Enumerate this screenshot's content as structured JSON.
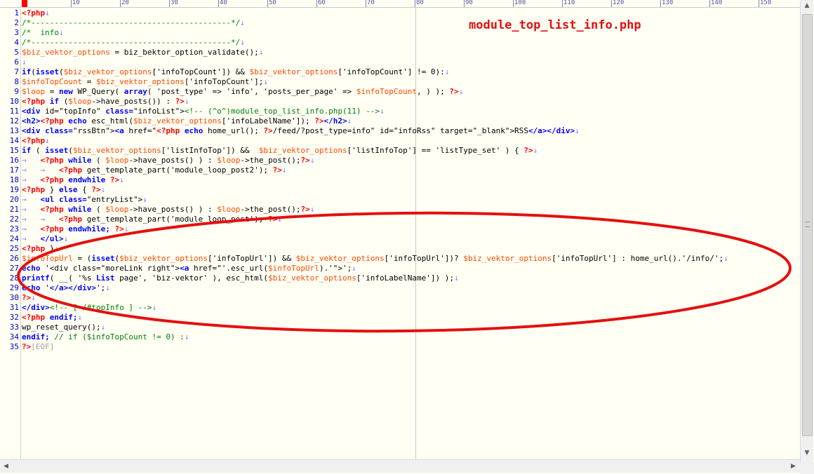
{
  "annotation": {
    "filename": "module_top_list_info.php"
  },
  "ruler": {
    "labels": [
      "10",
      "20",
      "30",
      "40",
      "50",
      "60",
      "70",
      "80",
      "90",
      "100",
      "110",
      "120",
      "130",
      "140",
      "150"
    ]
  },
  "lines": [
    {
      "num": "1",
      "tokens": [
        [
          "php",
          "<?php"
        ],
        [
          "nl",
          "↓"
        ]
      ]
    },
    {
      "num": "2",
      "tokens": [
        [
          "com",
          "/*-------------------------------------------*/"
        ],
        [
          "nl",
          "↓"
        ]
      ]
    },
    {
      "num": "3",
      "tokens": [
        [
          "com",
          "/*  info"
        ],
        [
          "nl",
          "↓"
        ]
      ]
    },
    {
      "num": "4",
      "tokens": [
        [
          "com",
          "/*-------------------------------------------*/"
        ],
        [
          "nl",
          "↓"
        ]
      ]
    },
    {
      "num": "5",
      "tokens": [
        [
          "var",
          "$biz_vektor_options"
        ],
        [
          "str",
          " = biz_bektor_option_validate();"
        ],
        [
          "nl",
          "↓"
        ]
      ]
    },
    {
      "num": "6",
      "tokens": [
        [
          "nl",
          "↓"
        ]
      ]
    },
    {
      "num": "7",
      "tokens": [
        [
          "kw",
          "if"
        ],
        [
          "str",
          "("
        ],
        [
          "kw",
          "isset"
        ],
        [
          "str",
          "("
        ],
        [
          "var",
          "$biz_vektor_options"
        ],
        [
          "str",
          "['infoTopCount']) && "
        ],
        [
          "var",
          "$biz_vektor_options"
        ],
        [
          "str",
          "['infoTopCount'] != 0):"
        ],
        [
          "nl",
          "↓"
        ]
      ]
    },
    {
      "num": "8",
      "tokens": [
        [
          "var",
          "$infoTopCount"
        ],
        [
          "str",
          " = "
        ],
        [
          "var",
          "$biz_vektor_options"
        ],
        [
          "str",
          "['infoTopCount'];"
        ],
        [
          "nl",
          "↓"
        ]
      ]
    },
    {
      "num": "9",
      "tokens": [
        [
          "var",
          "$loop"
        ],
        [
          "str",
          " = "
        ],
        [
          "kw",
          "new"
        ],
        [
          "str",
          " WP_Query( "
        ],
        [
          "kw",
          "array"
        ],
        [
          "str",
          "( 'post_type' => 'info', 'posts_per_page' => "
        ],
        [
          "var",
          "$infoTopCount"
        ],
        [
          "str",
          ", ) ); "
        ],
        [
          "php",
          "?>"
        ],
        [
          "nl",
          "↓"
        ]
      ]
    },
    {
      "num": "10",
      "tokens": [
        [
          "php",
          "<?php"
        ],
        [
          "str",
          " "
        ],
        [
          "kw",
          "if"
        ],
        [
          "str",
          " ("
        ],
        [
          "var",
          "$loop"
        ],
        [
          "str",
          "->have_posts()) : "
        ],
        [
          "php",
          "?>"
        ],
        [
          "nl",
          "↓"
        ]
      ]
    },
    {
      "num": "11",
      "tokens": [
        [
          "kw",
          "<div"
        ],
        [
          "str",
          " id=\"topInfo\" "
        ],
        [
          "kw",
          "class="
        ],
        [
          "str",
          "\"infoList\">"
        ],
        [
          "com",
          "<!-- (^o^)module_top_list_info.php(11) -->"
        ],
        [
          "nl",
          "↓"
        ]
      ]
    },
    {
      "num": "12",
      "tokens": [
        [
          "kw",
          "<h2>"
        ],
        [
          "php",
          "<?php"
        ],
        [
          "str",
          " "
        ],
        [
          "kw",
          "echo"
        ],
        [
          "str",
          " esc_html("
        ],
        [
          "var",
          "$biz_vektor_options"
        ],
        [
          "str",
          "['infoLabelName']); "
        ],
        [
          "php",
          "?>"
        ],
        [
          "kw",
          "</h2>"
        ],
        [
          "nl",
          "↓"
        ]
      ]
    },
    {
      "num": "13",
      "tokens": [
        [
          "kw",
          "<div"
        ],
        [
          "str",
          " "
        ],
        [
          "kw",
          "class="
        ],
        [
          "str",
          "\"rssBtn\">"
        ],
        [
          "kw",
          "<a"
        ],
        [
          "str",
          " href=\""
        ],
        [
          "php",
          "<?php"
        ],
        [
          "str",
          " "
        ],
        [
          "kw",
          "echo"
        ],
        [
          "str",
          " home_url(); "
        ],
        [
          "php",
          "?>"
        ],
        [
          "str",
          "/feed/?post_type=info\" id=\"infoRss\" target=\"_blank\">RSS"
        ],
        [
          "kw",
          "</a></div>"
        ],
        [
          "nl",
          "↓"
        ]
      ]
    },
    {
      "num": "14",
      "tokens": [
        [
          "php",
          "<?php"
        ],
        [
          "nl",
          "↓"
        ]
      ]
    },
    {
      "num": "15",
      "tokens": [
        [
          "kw",
          "if"
        ],
        [
          "str",
          " ( "
        ],
        [
          "kw",
          "isset"
        ],
        [
          "str",
          "("
        ],
        [
          "var",
          "$biz_vektor_options"
        ],
        [
          "str",
          "['listInfoTop']) &&  "
        ],
        [
          "var",
          "$biz_vektor_options"
        ],
        [
          "str",
          "['listInfoTop'] == 'listType_set' ) { "
        ],
        [
          "php",
          "?>"
        ],
        [
          "nl",
          "↓"
        ]
      ]
    },
    {
      "num": "16",
      "tokens": [
        [
          "tab",
          "→   "
        ],
        [
          "php",
          "<?php"
        ],
        [
          "str",
          " "
        ],
        [
          "kw",
          "while"
        ],
        [
          "str",
          " ( "
        ],
        [
          "var",
          "$loop"
        ],
        [
          "str",
          "->have_posts() ) : "
        ],
        [
          "var",
          "$loop"
        ],
        [
          "str",
          "->the_post();"
        ],
        [
          "php",
          "?>"
        ],
        [
          "nl",
          "↓"
        ]
      ]
    },
    {
      "num": "17",
      "tokens": [
        [
          "tab",
          "→   →   "
        ],
        [
          "php",
          "<?php"
        ],
        [
          "str",
          " get_template_part('module_loop_post2'); "
        ],
        [
          "php",
          "?>"
        ],
        [
          "nl",
          "↓"
        ]
      ]
    },
    {
      "num": "18",
      "tokens": [
        [
          "tab",
          "→   "
        ],
        [
          "php",
          "<?php"
        ],
        [
          "str",
          " "
        ],
        [
          "kw",
          "endwhile"
        ],
        [
          "str",
          " "
        ],
        [
          "php",
          "?>"
        ],
        [
          "nl",
          "↓"
        ]
      ]
    },
    {
      "num": "19",
      "tokens": [
        [
          "php",
          "<?php"
        ],
        [
          "str",
          " } "
        ],
        [
          "kw",
          "else"
        ],
        [
          "str",
          " { "
        ],
        [
          "php",
          "?>"
        ],
        [
          "nl",
          "↓"
        ]
      ]
    },
    {
      "num": "20",
      "tokens": [
        [
          "tab",
          "→   "
        ],
        [
          "kw",
          "<ul"
        ],
        [
          "str",
          " "
        ],
        [
          "kw",
          "class="
        ],
        [
          "str",
          "\"entryList\">"
        ],
        [
          "nl",
          "↓"
        ]
      ]
    },
    {
      "num": "21",
      "tokens": [
        [
          "tab",
          "→   "
        ],
        [
          "php",
          "<?php"
        ],
        [
          "str",
          " "
        ],
        [
          "kw",
          "while"
        ],
        [
          "str",
          " ( "
        ],
        [
          "var",
          "$loop"
        ],
        [
          "str",
          "->have_posts() ) : "
        ],
        [
          "var",
          "$loop"
        ],
        [
          "str",
          "->the_post();"
        ],
        [
          "php",
          "?>"
        ],
        [
          "nl",
          "↓"
        ]
      ]
    },
    {
      "num": "22",
      "tokens": [
        [
          "tab",
          "→   →   "
        ],
        [
          "php",
          "<?php"
        ],
        [
          "str",
          " get_template_part('module_loop_post'); "
        ],
        [
          "php",
          "?>"
        ],
        [
          "nl",
          "↓"
        ]
      ]
    },
    {
      "num": "23",
      "tokens": [
        [
          "tab",
          "→   "
        ],
        [
          "php",
          "<?php"
        ],
        [
          "str",
          " "
        ],
        [
          "kw",
          "endwhile;"
        ],
        [
          "str",
          " "
        ],
        [
          "php",
          "?>"
        ],
        [
          "nl",
          "↓"
        ]
      ]
    },
    {
      "num": "24",
      "tokens": [
        [
          "tab",
          "→   "
        ],
        [
          "kw",
          "</ul>"
        ],
        [
          "nl",
          "↓"
        ]
      ]
    },
    {
      "num": "25",
      "tokens": [
        [
          "php",
          "<?php"
        ],
        [
          "str",
          " }"
        ],
        [
          "nl",
          "↓"
        ]
      ]
    },
    {
      "num": "26",
      "tokens": [
        [
          "var",
          "$infoTopUrl"
        ],
        [
          "str",
          " = ("
        ],
        [
          "kw",
          "isset"
        ],
        [
          "str",
          "("
        ],
        [
          "var",
          "$biz_vektor_options"
        ],
        [
          "str",
          "['infoTopUrl']) && "
        ],
        [
          "var",
          "$biz_vektor_options"
        ],
        [
          "str",
          "['infoTopUrl'])? "
        ],
        [
          "var",
          "$biz_vektor_options"
        ],
        [
          "str",
          "['infoTopUrl'] : home_url().'/info/';"
        ],
        [
          "nl",
          "↓"
        ]
      ]
    },
    {
      "num": "27",
      "tokens": [
        [
          "kw",
          "echo"
        ],
        [
          "str",
          " '<div class=\"moreLink right\">"
        ],
        [
          "kw",
          "<a"
        ],
        [
          "str",
          " href=\"'.esc_url("
        ],
        [
          "var",
          "$infoTopUrl"
        ],
        [
          "str",
          ").'\">';"
        ],
        [
          "nl",
          "↓"
        ]
      ]
    },
    {
      "num": "28",
      "tokens": [
        [
          "kw",
          "printf"
        ],
        [
          "str",
          "( __( '%s "
        ],
        [
          "kw",
          "List"
        ],
        [
          "str",
          " page', 'biz-vektor' ), esc_html("
        ],
        [
          "var",
          "$biz_vektor_options"
        ],
        [
          "str",
          "['infoLabelName']) );"
        ],
        [
          "nl",
          "↓"
        ]
      ]
    },
    {
      "num": "29",
      "tokens": [
        [
          "kw",
          "echo"
        ],
        [
          "str",
          " '"
        ],
        [
          "kw",
          "</a></div>"
        ],
        [
          "str",
          "';"
        ],
        [
          "nl",
          "↓"
        ]
      ]
    },
    {
      "num": "30",
      "tokens": [
        [
          "php",
          "?>"
        ],
        [
          "nl",
          "↓"
        ]
      ]
    },
    {
      "num": "31",
      "tokens": [
        [
          "kw",
          "</div>"
        ],
        [
          "com",
          "<!-- [ /#topInfo ] -->"
        ],
        [
          "nl",
          "↓"
        ]
      ]
    },
    {
      "num": "32",
      "tokens": [
        [
          "php",
          "<?php"
        ],
        [
          "str",
          " "
        ],
        [
          "kw",
          "endif;"
        ],
        [
          "nl",
          "↓"
        ]
      ]
    },
    {
      "num": "33",
      "tokens": [
        [
          "str",
          "wp_reset_query();"
        ],
        [
          "nl",
          "↓"
        ]
      ]
    },
    {
      "num": "34",
      "tokens": [
        [
          "kw",
          "endif;"
        ],
        [
          "str",
          " "
        ],
        [
          "com",
          "// if ($infoTopCount != 0) :"
        ],
        [
          "nl",
          "↓"
        ]
      ]
    },
    {
      "num": "35",
      "tokens": [
        [
          "php",
          "?>"
        ],
        [
          "eof",
          "[EOF]"
        ]
      ]
    }
  ],
  "scrollbar": {
    "up_arrow": "▲",
    "down_arrow": "▼",
    "left_arrow": "◀",
    "right_arrow": "▶"
  },
  "colors": {
    "keyword": "#0000ff",
    "variable": "#ff4a00",
    "comment": "#008000",
    "php_tag": "#ff0000",
    "annotation": "#e01010",
    "background": "#fffff4"
  }
}
